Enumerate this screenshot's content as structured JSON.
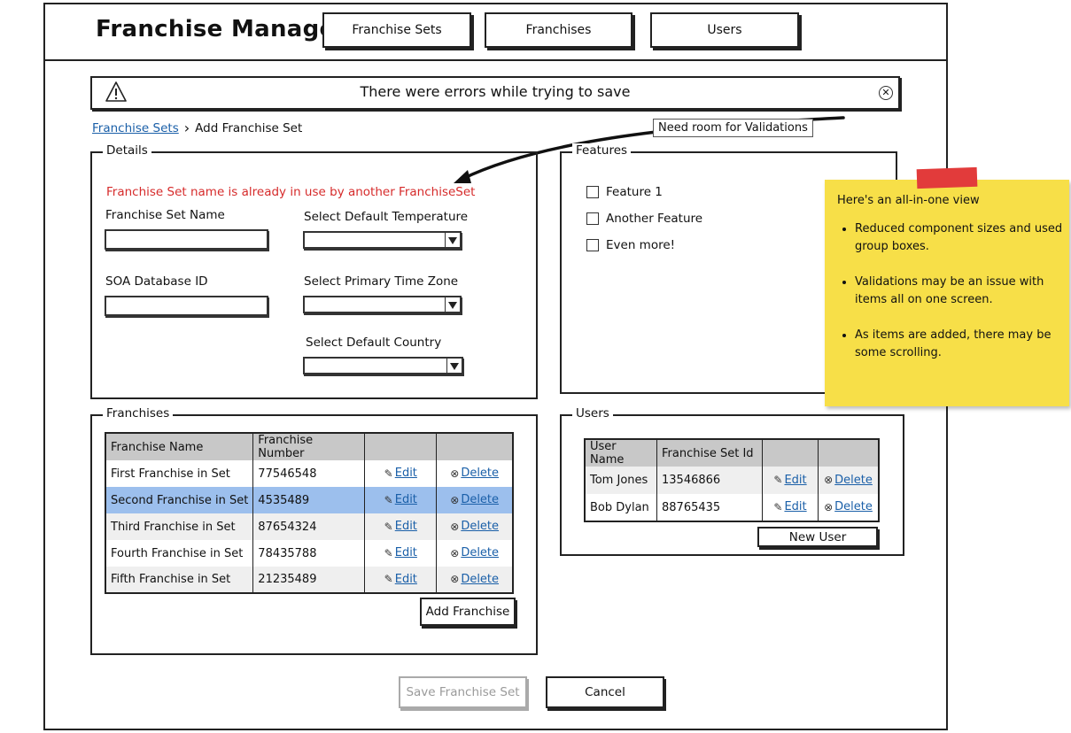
{
  "app": {
    "title": "Franchise Manager"
  },
  "nav": [
    "Franchise Sets",
    "Franchises",
    "Users"
  ],
  "alert": {
    "message": "There were errors while trying to save"
  },
  "breadcrumb": {
    "parent": "Franchise Sets",
    "separator": "›",
    "current": "Add Franchise Set"
  },
  "callout": {
    "text": "Need room for Validations"
  },
  "details": {
    "legend": "Details",
    "error": "Franchise Set name is already in use by another FranchiseSet",
    "fields": {
      "name_label": "Franchise Set Name",
      "name_value": "",
      "soa_label": "SOA Database ID",
      "soa_value": "",
      "temperature_label": "Select Default Temperature",
      "timezone_label": "Select Primary Time Zone",
      "country_label": "Select Default Country"
    }
  },
  "features": {
    "legend": "Features",
    "items": [
      {
        "label": "Feature 1",
        "checked": false
      },
      {
        "label": "Another Feature",
        "checked": false
      },
      {
        "label": "Even more!",
        "checked": false
      }
    ]
  },
  "franchises": {
    "legend": "Franchises",
    "columns": [
      "Franchise Name",
      "Franchise Number",
      "",
      ""
    ],
    "rows": [
      {
        "name": "First Franchise in Set",
        "number": "77546548",
        "edit": "Edit",
        "delete": "Delete"
      },
      {
        "name": "Second Franchise in Set",
        "number": "4535489",
        "edit": "Edit",
        "delete": "Delete"
      },
      {
        "name": "Third Franchise in Set",
        "number": "87654324",
        "edit": "Edit",
        "delete": "Delete"
      },
      {
        "name": "Fourth Franchise in Set",
        "number": "78435788",
        "edit": "Edit",
        "delete": "Delete"
      },
      {
        "name": "Fifth Franchise in Set",
        "number": "21235489",
        "edit": "Edit",
        "delete": "Delete"
      }
    ],
    "selected_row": 1,
    "add_label": "Add Franchise"
  },
  "users": {
    "legend": "Users",
    "columns": [
      "User Name",
      "Franchise Set Id",
      "",
      ""
    ],
    "rows": [
      {
        "name": "Tom Jones",
        "id": "13546866",
        "edit": "Edit",
        "delete": "Delete"
      },
      {
        "name": "Bob Dylan",
        "id": "88765435",
        "edit": "Edit",
        "delete": "Delete"
      }
    ],
    "new_label": "New User"
  },
  "sticky": {
    "title": "Here's an all-in-one view",
    "bullets": [
      "Reduced component sizes and used group boxes.",
      "Validations may be an issue with items all on one screen.",
      "As items are added, there may be some scrolling."
    ]
  },
  "footer": {
    "save_label": "Save Franchise Set",
    "cancel_label": "Cancel"
  },
  "colors": {
    "error": "#d62b2b",
    "link": "#1a5fa8",
    "selected_row": "#9cbfed",
    "sticky": "#f7df48",
    "tape": "#e23b3b"
  }
}
